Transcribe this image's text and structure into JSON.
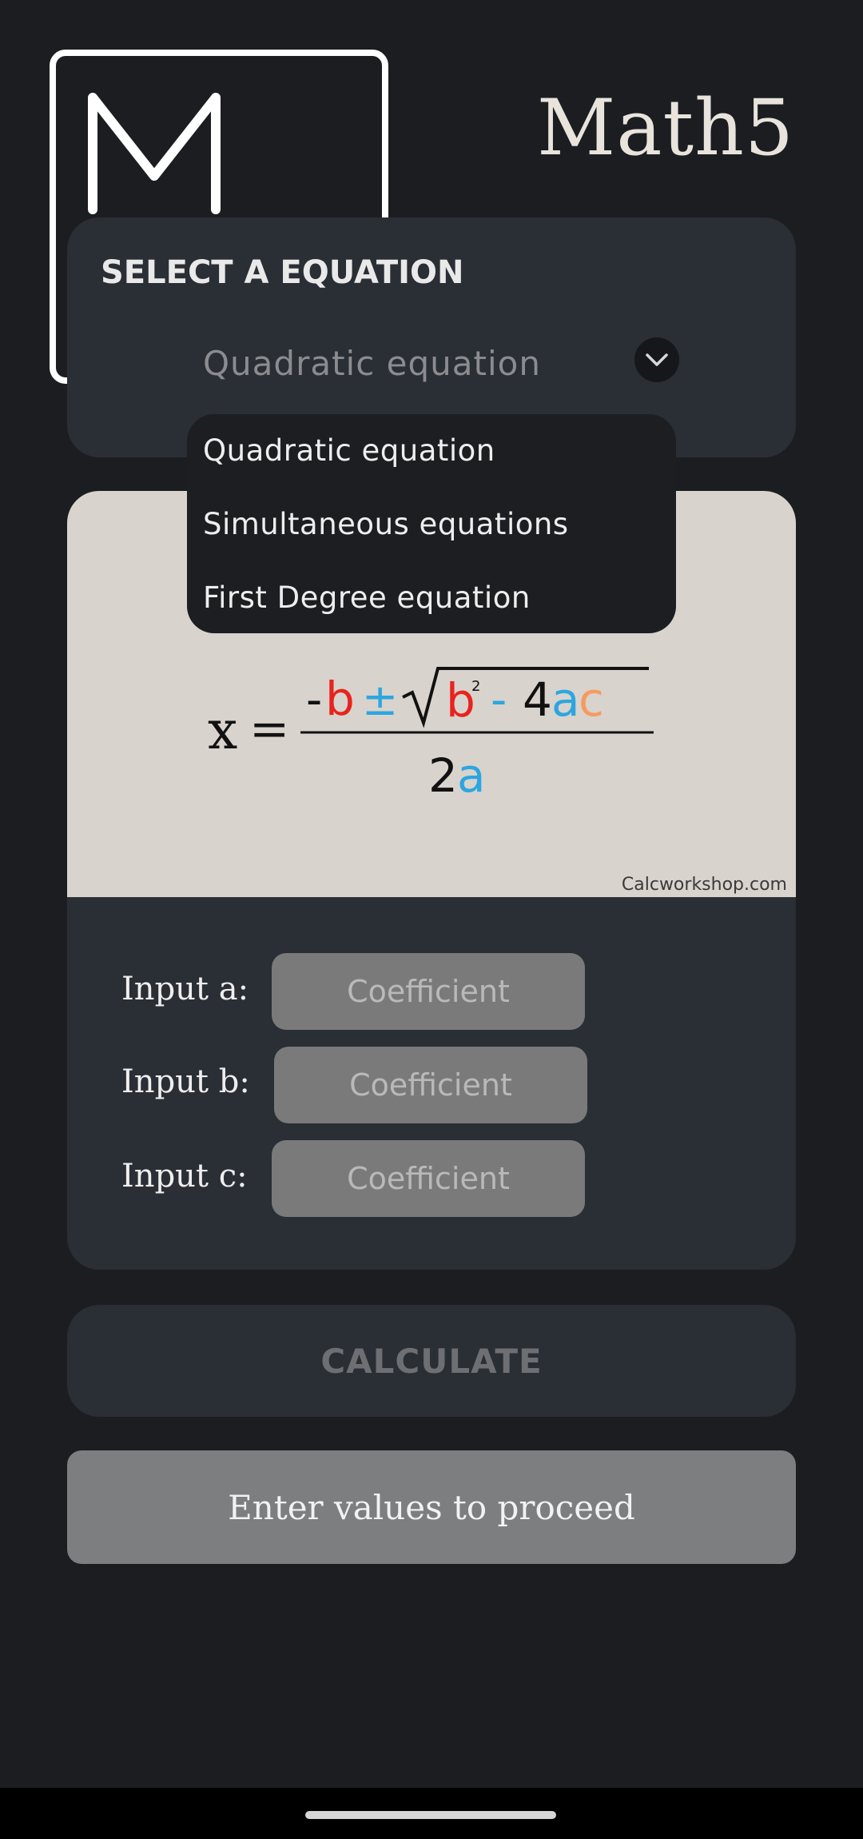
{
  "app": {
    "title": "Math5",
    "logo_letter": "M"
  },
  "selector": {
    "heading": "SELECT A EQUATION",
    "selected": "Quadratic equation",
    "options": [
      "Quadratic equation",
      "Simultaneous equations",
      "First Degree equation"
    ]
  },
  "formula": {
    "lhs": "x",
    "equals": "=",
    "numerator": {
      "neg_b": "-b",
      "pm": "±",
      "b": "b",
      "exp": "2",
      "minus": "-",
      "four": "4",
      "a": "a",
      "c": "c"
    },
    "denominator": {
      "two": "2",
      "a": "a"
    },
    "credit": "Calcworkshop.com"
  },
  "inputs": [
    {
      "label": "Input a:",
      "placeholder": "Coefficient"
    },
    {
      "label": "Input b:",
      "placeholder": "Coefficient"
    },
    {
      "label": "Input c:",
      "placeholder": "Coefficient"
    }
  ],
  "calculate_label": "CALCULATE",
  "status_text": "Enter values to proceed",
  "colors": {
    "background": "#1b1d21",
    "card": "#2a2e35",
    "formula_red": "#e8231e",
    "formula_blue": "#2ca6e0",
    "formula_orange": "#f79a60"
  }
}
